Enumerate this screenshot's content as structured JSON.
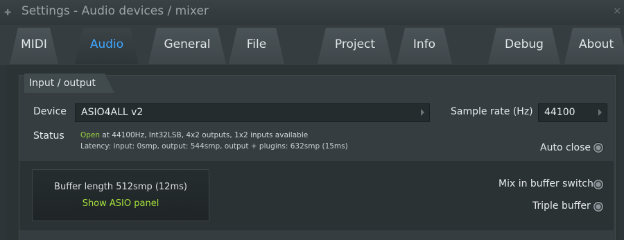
{
  "window": {
    "title": "Settings - Audio devices / mixer"
  },
  "tabs": [
    {
      "label": "MIDI",
      "active": false
    },
    {
      "label": "Audio",
      "active": true
    },
    {
      "label": "General",
      "active": false
    },
    {
      "label": "File",
      "active": false
    },
    {
      "label": "Project",
      "active": false
    },
    {
      "label": "Info",
      "active": false
    },
    {
      "label": "Debug",
      "active": false
    },
    {
      "label": "About",
      "active": false
    }
  ],
  "io": {
    "section_label": "Input / output",
    "device_label": "Device",
    "device_value": "ASIO4ALL v2",
    "sample_rate_label": "Sample rate (Hz)",
    "sample_rate_value": "44100",
    "status_label": "Status",
    "status_open": "Open",
    "status_line1": " at 44100Hz, Int32LSB, 4x2 outputs, 1x2 inputs available",
    "status_line2": "Latency: input: 0smp, output: 544smp, output + plugins: 632smp (15ms)",
    "auto_close_label": "Auto close"
  },
  "buffer": {
    "length_label": "Buffer length 512smp (12ms)",
    "asio_panel_label": "Show ASIO panel",
    "mix_in_buffer_switch_label": "Mix in buffer switch",
    "triple_buffer_label": "Triple buffer"
  },
  "colors": {
    "accent_blue": "#40a6ff",
    "status_green": "#9ad43c",
    "link_green": "#a7e23c"
  }
}
